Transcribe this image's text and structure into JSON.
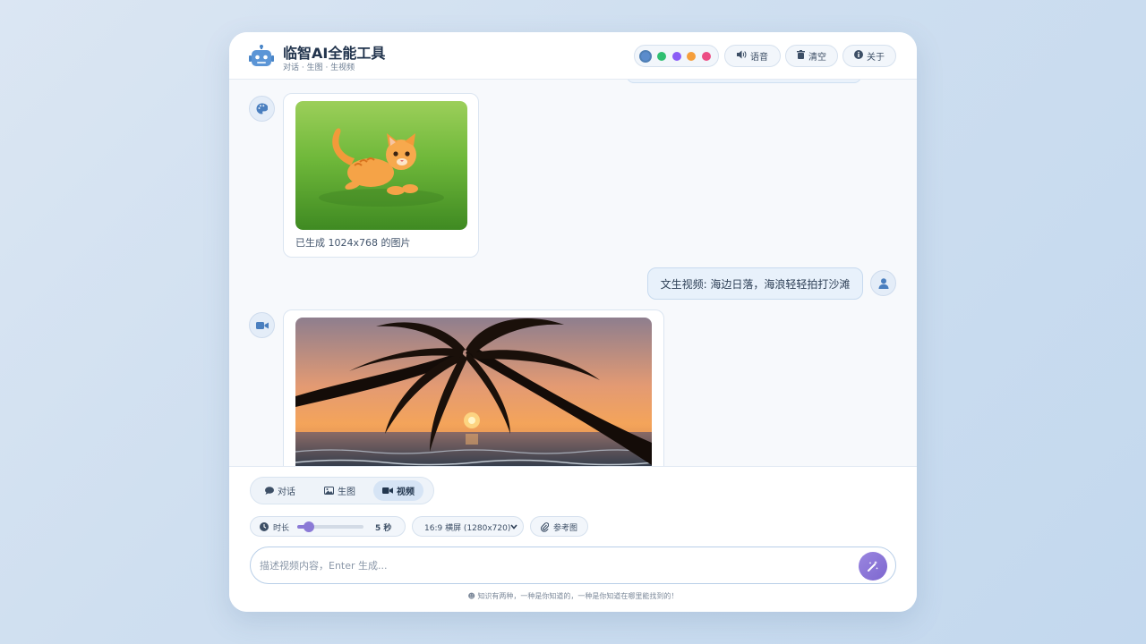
{
  "header": {
    "title": "临智AI全能工具",
    "subtitle": "对话 · 生图 · 生视频",
    "theme_colors": [
      "#5b8ccc",
      "#2fbf71",
      "#8b5cf6",
      "#f59e3b",
      "#ec4d84"
    ],
    "buttons": {
      "voice": "语音",
      "clear": "清空",
      "about": "关于"
    }
  },
  "chat": {
    "image_result": {
      "caption": "已生成 1024x768 的图片"
    },
    "user_message": "文生视频: 海边日落，海浪轻轻拍打沙滩"
  },
  "panel": {
    "modes": [
      {
        "label": "对话",
        "icon": "chat-bubble-icon"
      },
      {
        "label": "生图",
        "icon": "image-icon"
      },
      {
        "label": "视频",
        "icon": "video-camera-icon",
        "active": true
      }
    ],
    "duration": {
      "label": "时长",
      "value": "5 秒",
      "level": 0.12
    },
    "aspect_select": "16:9 横屏 (1280x720)",
    "reference_label": "参考图",
    "input_placeholder": "描述视频内容，Enter 生成...",
    "footer_note": "知识有两种，一种是你知道的，一种是你知道在哪里能找到的！"
  }
}
